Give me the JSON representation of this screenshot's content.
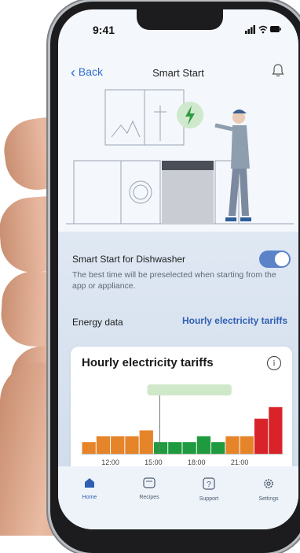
{
  "status_bar": {
    "time": "9:41",
    "icons": "signal-wifi-battery"
  },
  "nav": {
    "back_label": "Back",
    "title": "Smart Start",
    "bell_icon": "bell-icon"
  },
  "smart_start": {
    "label": "Smart Start for Dishwasher",
    "enabled": true,
    "description": "The best time will be preselected when starting from the app or appliance."
  },
  "energy": {
    "label": "Energy data",
    "link_label": "Hourly electricity tariffs"
  },
  "card": {
    "title": "Hourly electricity tariffs",
    "info_icon": "info-icon"
  },
  "chart_data": {
    "type": "bar",
    "x_ticks": [
      "12:00",
      "15:00",
      "18:00",
      "21:00"
    ],
    "hours": [
      10,
      11,
      12,
      13,
      14,
      15,
      16,
      17,
      18,
      19,
      20,
      21,
      22,
      23
    ],
    "values": [
      2,
      3,
      3,
      3,
      4,
      2,
      2,
      2,
      3,
      2,
      3,
      3,
      6,
      8
    ],
    "levels": [
      "medium",
      "medium",
      "medium",
      "medium",
      "medium",
      "low",
      "low",
      "low",
      "low",
      "low",
      "medium",
      "medium",
      "high",
      "high"
    ],
    "colors": {
      "low": "#1f9a3f",
      "medium": "#e6842a",
      "high": "#d8232a"
    },
    "highlight_start_index": 5,
    "highlight_end_index": 9,
    "ylim": [
      0,
      10
    ]
  },
  "tabs": [
    {
      "label": "Home",
      "icon": "home-icon",
      "active": true
    },
    {
      "label": "Recipes",
      "icon": "recipes-icon",
      "active": false
    },
    {
      "label": "Support",
      "icon": "support-icon",
      "active": false
    },
    {
      "label": "Settings",
      "icon": "settings-icon",
      "active": false
    }
  ]
}
